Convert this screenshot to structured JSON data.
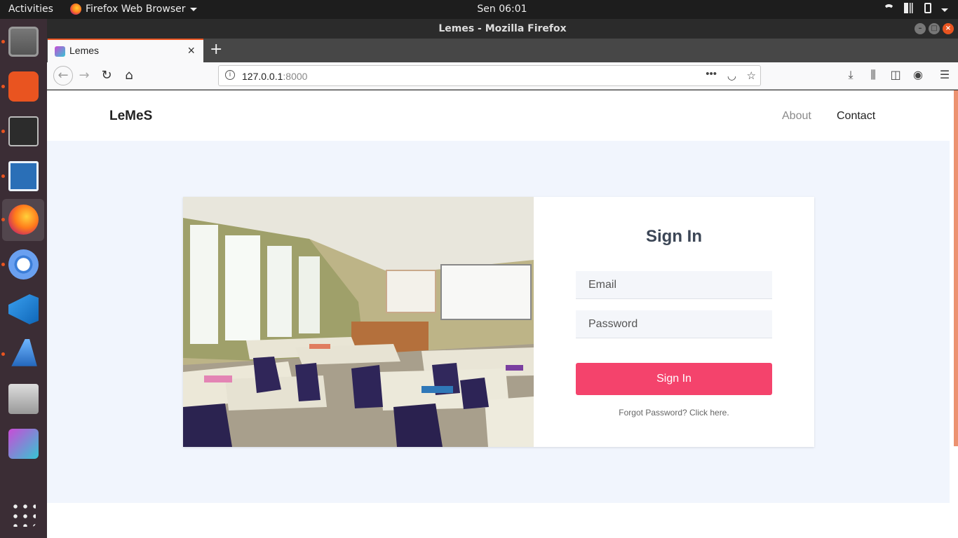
{
  "topbar": {
    "activities": "Activities",
    "app_menu": "Firefox Web Browser",
    "clock": "Sen 06:01"
  },
  "dock": {
    "items": [
      "Files",
      "Ubuntu Software",
      "Terminal",
      "LibreOffice Writer",
      "Firefox",
      "Chromium",
      "Visual Studio Code",
      "Wireshark",
      "Simple Scan",
      "Lemes",
      "Show Applications"
    ]
  },
  "window": {
    "title": "Lemes - Mozilla Firefox"
  },
  "tabs": [
    {
      "label": "Lemes",
      "active": true
    }
  ],
  "urlbar": {
    "host": "127.0.0.1",
    "port": ":8000"
  },
  "site": {
    "brand": "LeMeS",
    "nav": {
      "about": "About",
      "contact": "Contact"
    }
  },
  "signin": {
    "title": "Sign In",
    "email_placeholder": "Email",
    "password_placeholder": "Password",
    "button": "Sign In",
    "forgot": "Forgot Password? Click here."
  },
  "colors": {
    "accent": "#f4436c",
    "page_bg": "#f1f5fd",
    "dock_bg": "#3b2d35",
    "ubuntu_orange": "#e95420"
  }
}
